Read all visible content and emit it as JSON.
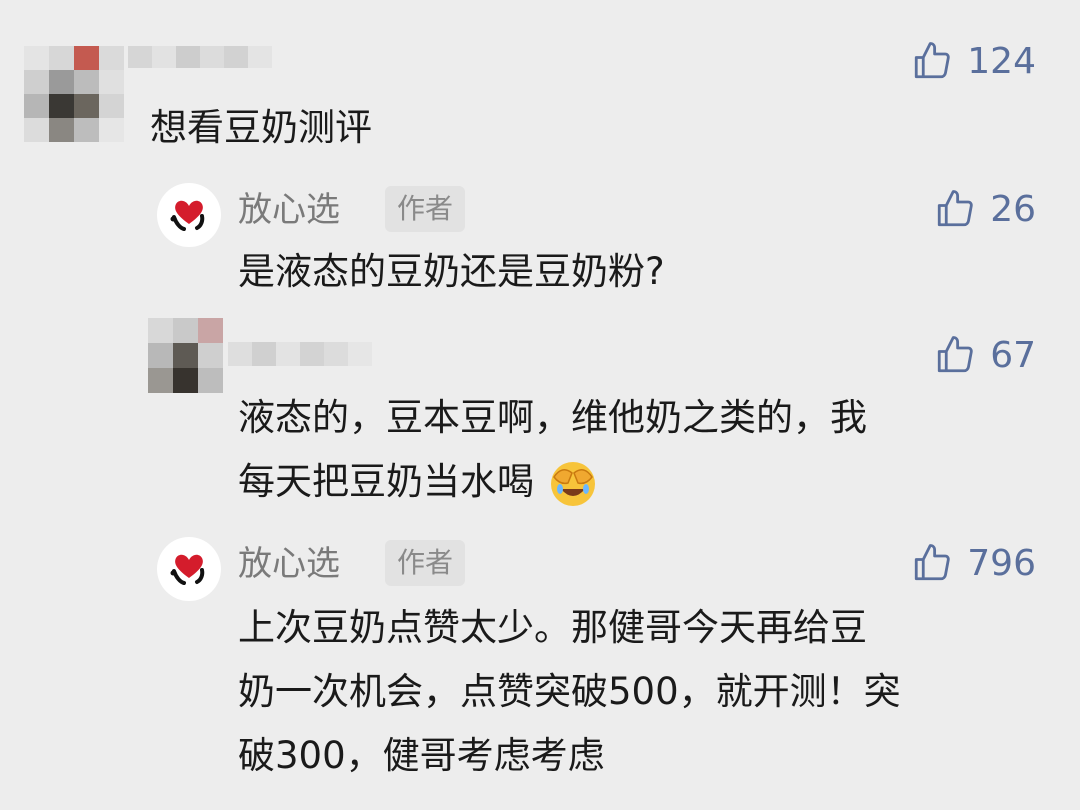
{
  "comments": [
    {
      "text": "想看豆奶测评",
      "likes": "124"
    },
    {
      "author": "放心选",
      "badge": "作者",
      "text": "是液态的豆奶还是豆奶粉?",
      "likes": "26"
    },
    {
      "text_line1": "液态的，豆本豆啊，维他奶之类的，我",
      "text_line2": "每天把豆奶当水喝",
      "likes": "67",
      "emoji": "face-with-hand-over-eyes-laughing"
    },
    {
      "author": "放心选",
      "badge": "作者",
      "text_line1": "上次豆奶点赞太少。那健哥今天再给豆",
      "text_line2": "奶一次机会，点赞突破500，就开测！突",
      "text_line3": "破300，健哥考虑考虑",
      "likes": "796"
    }
  ],
  "colors": {
    "background": "#ededed",
    "like_blue": "#5a6f9c",
    "brand_red": "#d41c2c"
  },
  "icons": [
    "thumbs-up-icon",
    "brand-heart-logo",
    "facepalm-laugh-emoji"
  ]
}
